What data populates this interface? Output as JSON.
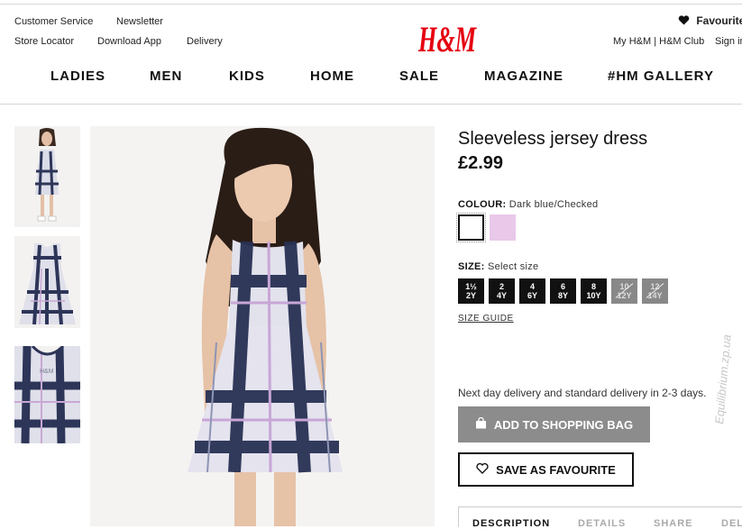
{
  "utility": {
    "customer_service": "Customer Service",
    "newsletter": "Newsletter",
    "store_locator": "Store Locator",
    "download_app": "Download App",
    "delivery": "Delivery",
    "favourites": "Favourite",
    "account": "My H&M | H&M Club",
    "sign_in": "Sign in"
  },
  "brand": {
    "logo_text": "H&M",
    "color": "#e50010"
  },
  "nav": [
    "LADIES",
    "MEN",
    "KIDS",
    "HOME",
    "SALE",
    "MAGAZINE",
    "#HM GALLERY"
  ],
  "product": {
    "title": "Sleeveless jersey dress",
    "price": "£2.99",
    "colour_label": "COLOUR:",
    "colour_value": "Dark blue/Checked",
    "swatches": [
      "#ffffff",
      "#e9c8ea"
    ],
    "size_label": "SIZE:",
    "size_value": "Select size",
    "sizes": [
      {
        "top": "1½",
        "bottom": "2Y",
        "available": true
      },
      {
        "top": "2",
        "bottom": "4Y",
        "available": true
      },
      {
        "top": "4",
        "bottom": "6Y",
        "available": true
      },
      {
        "top": "6",
        "bottom": "8Y",
        "available": true
      },
      {
        "top": "8",
        "bottom": "10Y",
        "available": true
      },
      {
        "top": "10",
        "bottom": "12Y",
        "available": false
      },
      {
        "top": "12",
        "bottom": "14Y",
        "available": false
      }
    ],
    "size_guide": "SIZE GUIDE",
    "delivery_note": "Next day delivery and standard delivery in 2-3 days.",
    "add_to_bag": "ADD TO SHOPPING BAG",
    "save_favourite": "SAVE AS FAVOURITE"
  },
  "tabs": [
    "DESCRIPTION",
    "DETAILS",
    "SHARE",
    "DEL"
  ],
  "watermark": "Equilibrium.zp.ua"
}
